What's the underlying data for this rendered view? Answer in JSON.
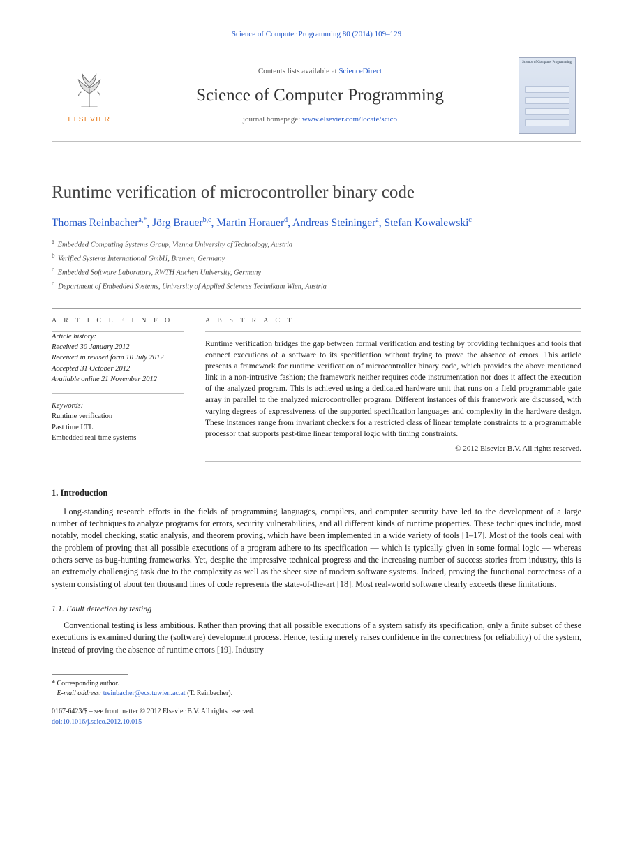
{
  "running_head": {
    "journal": "Science of Computer Programming",
    "cite": "80 (2014) 109–129"
  },
  "masthead": {
    "contents_prefix": "Contents lists available at ",
    "contents_link": "ScienceDirect",
    "journal_title": "Science of Computer Programming",
    "homepage_prefix": "journal homepage: ",
    "homepage_url": "www.elsevier.com/locate/scico",
    "publisher": "ELSEVIER",
    "cover_title": "Science of Computer Programming"
  },
  "article": {
    "title": "Runtime verification of microcontroller binary code",
    "authors_html": [
      {
        "name": "Thomas Reinbacher",
        "marks": "a,*"
      },
      {
        "name": "Jörg Brauer",
        "marks": "b,c"
      },
      {
        "name": "Martin Horauer",
        "marks": "d"
      },
      {
        "name": "Andreas Steininger",
        "marks": "a"
      },
      {
        "name": "Stefan Kowalewski",
        "marks": "c"
      }
    ],
    "affiliations": [
      {
        "mark": "a",
        "text": "Embedded Computing Systems Group, Vienna University of Technology, Austria"
      },
      {
        "mark": "b",
        "text": "Verified Systems International GmbH, Bremen, Germany"
      },
      {
        "mark": "c",
        "text": "Embedded Software Laboratory, RWTH Aachen University, Germany"
      },
      {
        "mark": "d",
        "text": "Department of Embedded Systems, University of Applied Sciences Technikum Wien, Austria"
      }
    ]
  },
  "info": {
    "heading": "A R T I C L E   I N F O",
    "history_label": "Article history:",
    "history": [
      "Received 30 January 2012",
      "Received in revised form 10 July 2012",
      "Accepted 31 October 2012",
      "Available online 21 November 2012"
    ],
    "keywords_label": "Keywords:",
    "keywords": [
      "Runtime verification",
      "Past time LTL",
      "Embedded real-time systems"
    ]
  },
  "abstract": {
    "heading": "A B S T R A C T",
    "text": "Runtime verification bridges the gap between formal verification and testing by providing techniques and tools that connect executions of a software to its specification without trying to prove the absence of errors. This article presents a framework for runtime verification of microcontroller binary code, which provides the above mentioned link in a non-intrusive fashion; the framework neither requires code instrumentation nor does it affect the execution of the analyzed program. This is achieved using a dedicated hardware unit that runs on a field programmable gate array in parallel to the analyzed microcontroller program. Different instances of this framework are discussed, with varying degrees of expressiveness of the supported specification languages and complexity in the hardware design. These instances range from invariant checkers for a restricted class of linear template constraints to a programmable processor that supports past-time linear temporal logic with timing constraints.",
    "copyright": "© 2012 Elsevier B.V. All rights reserved."
  },
  "sections": {
    "intro_head": "1. Introduction",
    "intro_p1": "Long-standing research efforts in the fields of programming languages, compilers, and computer security have led to the development of a large number of techniques to analyze programs for errors, security vulnerabilities, and all different kinds of runtime properties. These techniques include, most notably, model checking, static analysis, and theorem proving, which have been implemented in a wide variety of tools [1–17]. Most of the tools deal with the problem of proving that all possible executions of a program adhere to its specification — which is typically given in some formal logic — whereas others serve as bug-hunting frameworks. Yet, despite the impressive technical progress and the increasing number of success stories from industry, this is an extremely challenging task due to the complexity as well as the sheer size of modern software systems. Indeed, proving the functional correctness of a system consisting of about ten thousand lines of code represents the state-of-the-art [18]. Most real-world software clearly exceeds these limitations.",
    "sub11_head": "1.1. Fault detection by testing",
    "sub11_p1": "Conventional testing is less ambitious. Rather than proving that all possible executions of a system satisfy its specification, only a finite subset of these executions is examined during the (software) development process. Hence, testing merely raises confidence in the correctness (or reliability) of the system, instead of proving the absence of runtime errors [19]. Industry"
  },
  "footer": {
    "corr_label": "Corresponding author.",
    "email_label": "E-mail address:",
    "email": "treinbacher@ecs.tuwien.ac.at",
    "email_paren": "(T. Reinbacher).",
    "issn_line": "0167-6423/$ – see front matter © 2012 Elsevier B.V. All rights reserved.",
    "doi_label": "doi:",
    "doi": "10.1016/j.scico.2012.10.015"
  }
}
